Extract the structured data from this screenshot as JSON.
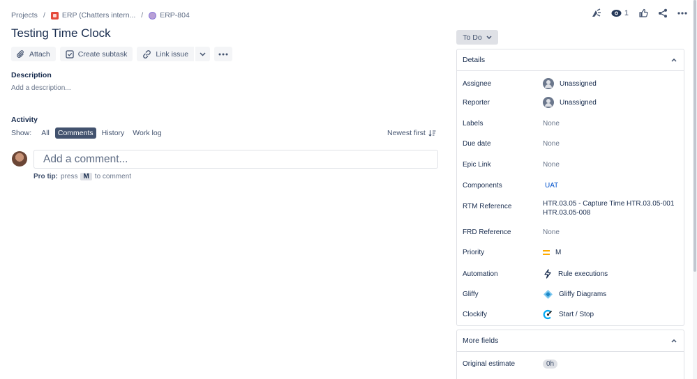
{
  "breadcrumb": {
    "projects": "Projects",
    "separator": "/",
    "project": "ERP (Chatters intern...",
    "issue_key": "ERP-804"
  },
  "header": {
    "watch_count": "1",
    "icons": [
      "feedback-icon",
      "eye-icon",
      "like-icon",
      "share-icon",
      "more-icon"
    ]
  },
  "issue": {
    "title": "Testing Time Clock"
  },
  "toolbar": {
    "attach": "Attach",
    "create_subtask": "Create subtask",
    "link_issue": "Link issue"
  },
  "description": {
    "label": "Description",
    "placeholder": "Add a description..."
  },
  "activity": {
    "label": "Activity",
    "show_label": "Show:",
    "filters": [
      "All",
      "Comments",
      "History",
      "Work log"
    ],
    "active_filter": "Comments",
    "sort": "Newest first",
    "comment_placeholder": "Add a comment...",
    "protip_bold": "Pro tip:",
    "protip_pre": "press",
    "protip_key": "M",
    "protip_post": "to comment"
  },
  "status": {
    "label": "To Do"
  },
  "details": {
    "title": "Details",
    "fields": [
      {
        "label": "Assignee",
        "value": "Unassigned"
      },
      {
        "label": "Reporter",
        "value": "Unassigned"
      },
      {
        "label": "Labels",
        "value": "None"
      },
      {
        "label": "Due date",
        "value": "None"
      },
      {
        "label": "Epic Link",
        "value": "None"
      },
      {
        "label": "Components",
        "value": "UAT"
      },
      {
        "label": "RTM Reference",
        "value": "HTR.03.05 - Capture Time HTR.03.05-001",
        "value2": "HTR.03.05-008"
      },
      {
        "label": "FRD Reference",
        "value": "None"
      },
      {
        "label": "Priority",
        "value": "M"
      },
      {
        "label": "Automation",
        "value": "Rule executions"
      },
      {
        "label": "Gliffy",
        "value": "Gliffy Diagrams"
      },
      {
        "label": "Clockify",
        "value": "Start / Stop"
      }
    ]
  },
  "more_fields": {
    "title": "More fields",
    "fields": [
      {
        "label": "Original estimate",
        "value": "0h"
      }
    ]
  },
  "colors": {
    "accent": "#0052cc",
    "active_chip": "#42526e",
    "priority": "#ffab00"
  }
}
